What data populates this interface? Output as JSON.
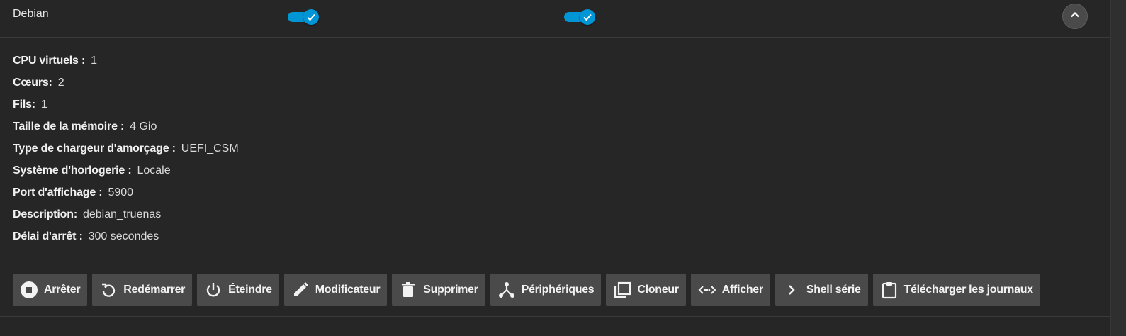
{
  "vm": {
    "name": "Debian",
    "autostart_enabled": true,
    "running_enabled": true
  },
  "details": [
    {
      "label": "CPU virtuels :",
      "value": "1"
    },
    {
      "label": "Cœurs:",
      "value": "2"
    },
    {
      "label": "Fils:",
      "value": "1"
    },
    {
      "label": "Taille de la mémoire :",
      "value": "4 Gio"
    },
    {
      "label": "Type de chargeur d'amorçage :",
      "value": "UEFI_CSM"
    },
    {
      "label": "Système d'horlogerie :",
      "value": "Locale"
    },
    {
      "label": "Port d'affichage :",
      "value": "5900"
    },
    {
      "label": "Description:",
      "value": "debian_truenas"
    },
    {
      "label": "Délai d'arrêt :",
      "value": "300 secondes"
    }
  ],
  "actions": [
    {
      "label": "Arrêter",
      "icon": "stop-circle-icon"
    },
    {
      "label": "Redémarrer",
      "icon": "restart-icon"
    },
    {
      "label": "Éteindre",
      "icon": "power-icon"
    },
    {
      "label": "Modificateur",
      "icon": "pencil-icon"
    },
    {
      "label": "Supprimer",
      "icon": "trash-icon"
    },
    {
      "label": "Périphériques",
      "icon": "devices-icon"
    },
    {
      "label": "Cloneur",
      "icon": "clone-icon"
    },
    {
      "label": "Afficher",
      "icon": "display-icon"
    },
    {
      "label": "Shell série",
      "icon": "chevron-right-icon"
    },
    {
      "label": "Télécharger les journaux",
      "icon": "clipboard-icon"
    }
  ],
  "colors": {
    "accent": "#0095d5",
    "background": "#262626",
    "button": "#4a4a4a"
  }
}
